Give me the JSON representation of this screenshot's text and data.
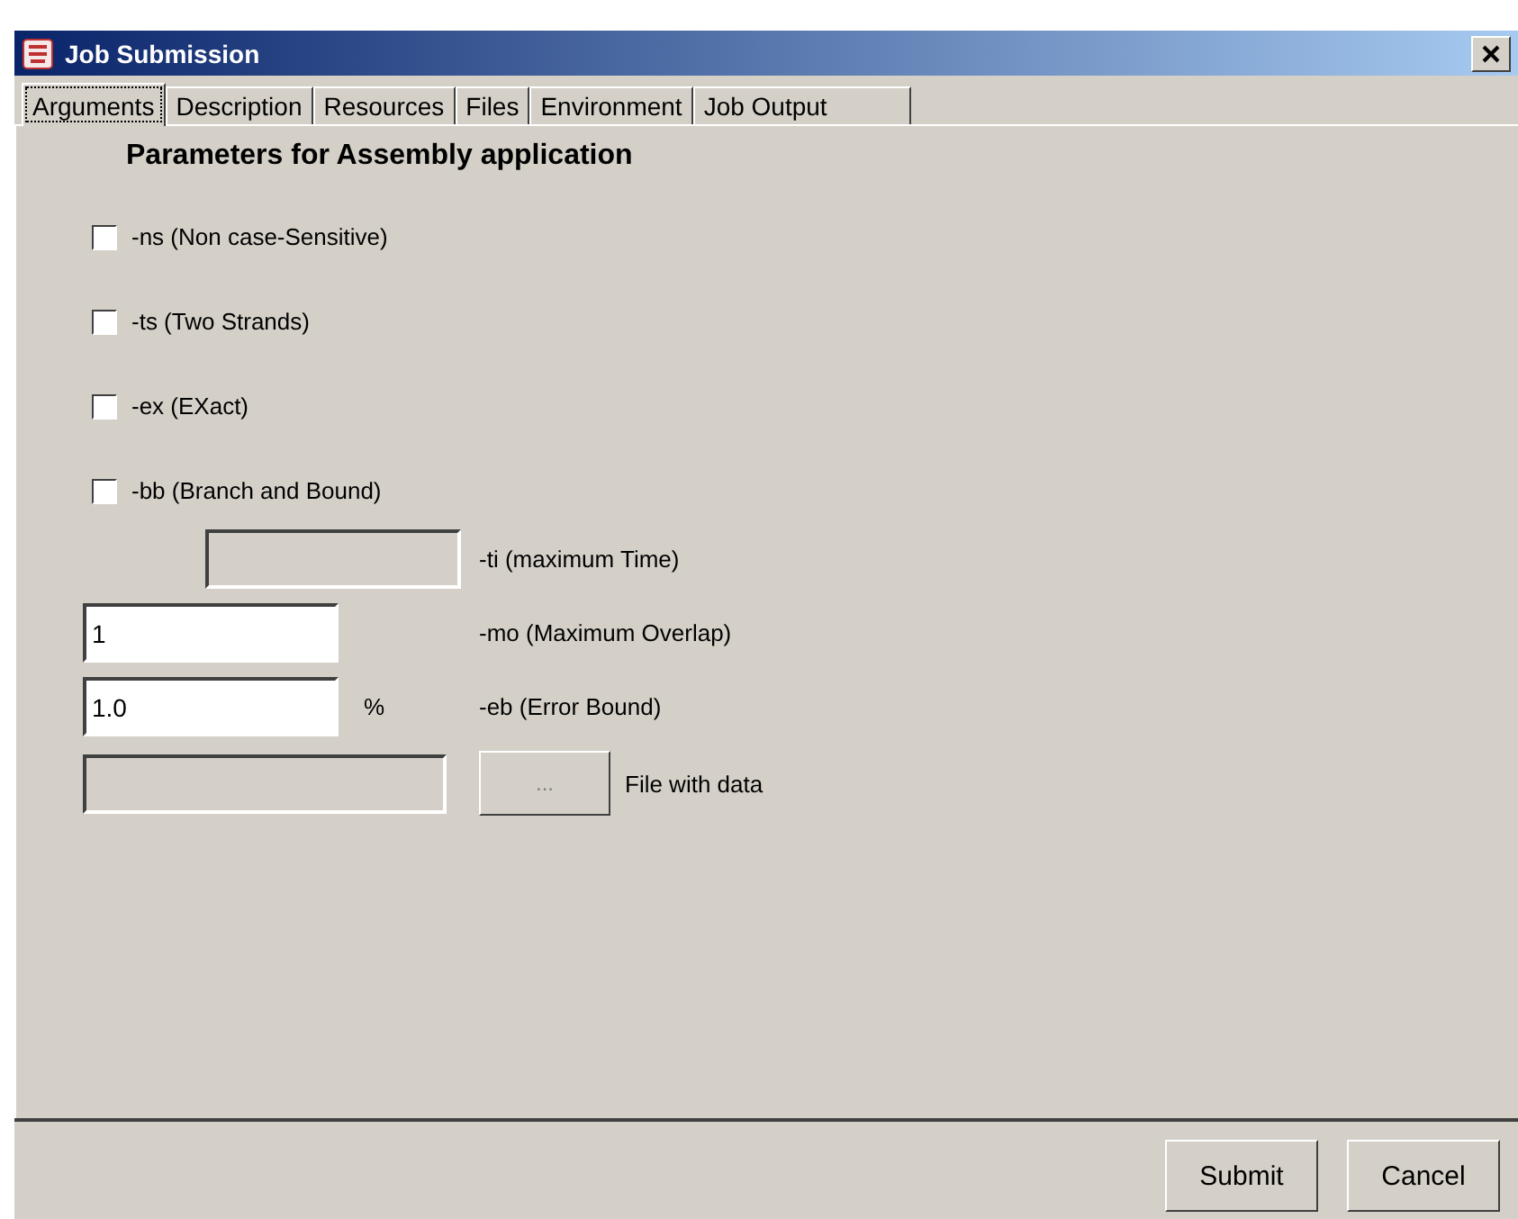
{
  "window": {
    "title": "Job Submission"
  },
  "tabs": [
    {
      "label": "Arguments",
      "selected": true
    },
    {
      "label": "Description",
      "selected": false
    },
    {
      "label": "Resources",
      "selected": false
    },
    {
      "label": "Files",
      "selected": false
    },
    {
      "label": "Environment",
      "selected": false
    },
    {
      "label": "Job Output",
      "selected": false
    }
  ],
  "heading": "Parameters for Assembly application",
  "options": [
    {
      "label": "-ns (Non case-Sensitive)",
      "checked": false
    },
    {
      "label": "-ts (Two Strands)",
      "checked": false
    },
    {
      "label": "-ex (EXact)",
      "checked": false
    },
    {
      "label": "-bb (Branch and Bound)",
      "checked": false
    }
  ],
  "parameters": [
    {
      "kind": "indented",
      "disabled": true,
      "label": "-ti (maximum Time)"
    },
    {
      "kind": "plain",
      "value": "1",
      "disabled": false,
      "label": "-mo (Maximum Overlap)"
    },
    {
      "kind": "unit",
      "value": "1.0",
      "disabled": false,
      "unit": "%",
      "label": "-eb (Error Bound)"
    },
    {
      "kind": "file",
      "disabled": true,
      "button": "...",
      "label": "File with data"
    }
  ],
  "buttons": [
    "Submit",
    "Cancel"
  ]
}
